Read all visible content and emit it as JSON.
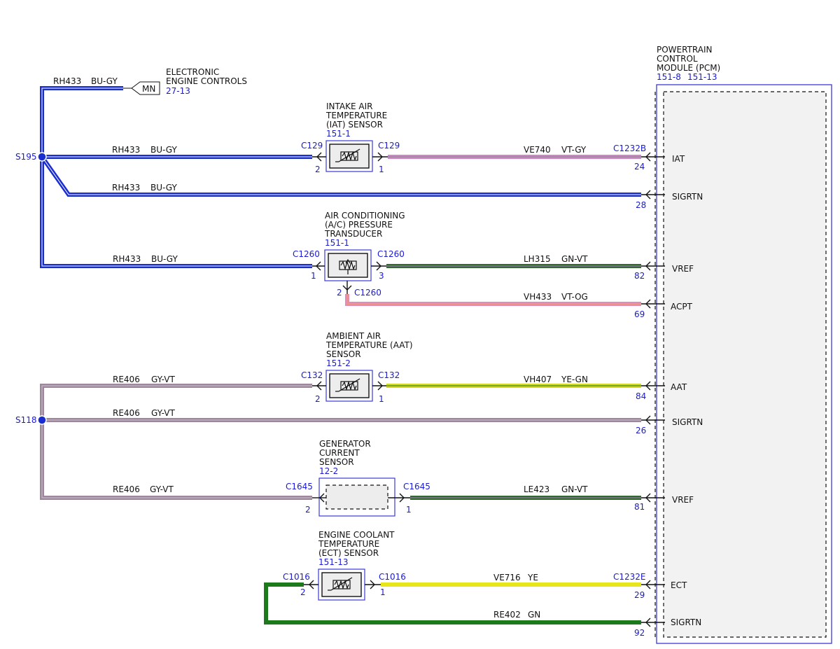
{
  "colors": {
    "blue_gray_wire": "#1a2ed0",
    "violet_gray_wire": "#cc88c8",
    "pink_wire": "#e58ab8",
    "green_violet_wire": "#2f6b2a",
    "gray_violet_wire": "#9d879b",
    "yellow_green_wire": "#d8d820",
    "yellow_wire": "#e6e61a",
    "green_wire": "#1c7a1c",
    "reference_text": "#1a1ad6",
    "module_border": "#3a3ad8",
    "module_fill": "#f2f2f2"
  },
  "pcm": {
    "title_line1": "POWERTRAIN",
    "title_line2": "CONTROL",
    "title_line3": "MODULE (PCM)",
    "ref1": "151-8",
    "ref2": "151-13",
    "connector_top": "C1232B",
    "connector_bottom": "C1232E"
  },
  "eec": {
    "line1": "ELECTRONIC",
    "line2": "ENGINE CONTROLS",
    "ref": "27-13",
    "box_label": "MN",
    "circuit": "RH433",
    "color": "BU-GY"
  },
  "splices": {
    "s195": "S195",
    "s118": "S118"
  },
  "iat": {
    "line1": "INTAKE AIR",
    "line2": "TEMPERATURE",
    "line3": "(IAT) SENSOR",
    "ref": "151-1",
    "conn_left": "C129",
    "conn_right": "C129",
    "pin_left": "2",
    "pin_right": "1"
  },
  "acp": {
    "line1": "AIR CONDITIONING",
    "line2": "(A/C) PRESSURE",
    "line3": "TRANSDUCER",
    "ref": "151-1",
    "conn_left": "C1260",
    "conn_right": "C1260",
    "conn_bottom": "C1260",
    "pin_left": "1",
    "pin_right": "3",
    "pin_bottom": "2"
  },
  "aat": {
    "line1": "AMBIENT AIR",
    "line2": "TEMPERATURE (AAT)",
    "line3": "SENSOR",
    "ref": "151-2",
    "conn_left": "C132",
    "conn_right": "C132",
    "pin_left": "2",
    "pin_right": "1"
  },
  "gen": {
    "line1": "GENERATOR",
    "line2": "CURRENT",
    "line3": "SENSOR",
    "ref": "12-2",
    "conn_left": "C1645",
    "conn_right": "C1645",
    "pin_left": "2",
    "pin_right": "1"
  },
  "ect": {
    "line1": "ENGINE COOLANT",
    "line2": "TEMPERATURE",
    "line3": "(ECT) SENSOR",
    "ref": "151-13",
    "conn_left": "C1016",
    "conn_right": "C1016",
    "pin_left": "2",
    "pin_right": "1"
  },
  "wires": {
    "w1": {
      "circuit": "RH433",
      "color": "BU-GY"
    },
    "w2": {
      "circuit": "RH433",
      "color": "BU-GY"
    },
    "w3": {
      "circuit": "RH433",
      "color": "BU-GY"
    },
    "w4": {
      "circuit": "VE740",
      "color": "VT-GY"
    },
    "w5": {
      "circuit": "LH315",
      "color": "GN-VT"
    },
    "w6": {
      "circuit": "VH433",
      "color": "VT-OG"
    },
    "w7": {
      "circuit": "RE406",
      "color": "GY-VT"
    },
    "w8": {
      "circuit": "VH407",
      "color": "YE-GN"
    },
    "w9": {
      "circuit": "RE406",
      "color": "GY-VT"
    },
    "w10": {
      "circuit": "RE406",
      "color": "GY-VT"
    },
    "w11": {
      "circuit": "LE423",
      "color": "GN-VT"
    },
    "w12": {
      "circuit": "VE716",
      "color": "YE"
    },
    "w13": {
      "circuit": "RE402",
      "color": "GN"
    }
  },
  "pins": {
    "iat": {
      "num": "24",
      "label": "IAT"
    },
    "sigrtn1": {
      "num": "28",
      "label": "SIGRTN"
    },
    "vref1": {
      "num": "82",
      "label": "VREF"
    },
    "acpt": {
      "num": "69",
      "label": "ACPT"
    },
    "aat": {
      "num": "84",
      "label": "AAT"
    },
    "sigrtn2": {
      "num": "26",
      "label": "SIGRTN"
    },
    "vref2": {
      "num": "81",
      "label": "VREF"
    },
    "ect": {
      "num": "29",
      "label": "ECT"
    },
    "sigrtn3": {
      "num": "92",
      "label": "SIGRTN"
    }
  }
}
